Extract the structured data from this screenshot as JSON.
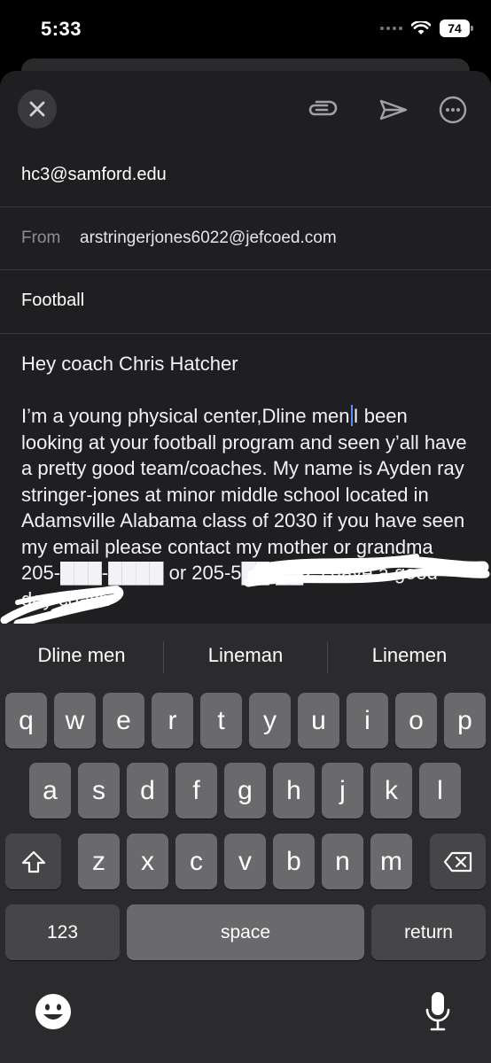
{
  "status_bar": {
    "time": "5:33",
    "battery": "74"
  },
  "compose": {
    "to": "hc3@samford.edu",
    "from_label": "From",
    "from": "arstringerjones6022@jefcoed.com",
    "subject": "Football",
    "greeting": "Hey coach Chris Hatcher",
    "body_before_cursor": "I’m a young physical center,Dline men",
    "body_after_cursor": "I been looking at your football program and seen y’all have a pretty good team/coaches. My name is Ayden ray stringer-jones at minor middle school located in Adamsville Alabama class of 2030 if you have seen my email please contact my mother or grandma 205-███-████ or 205-5██-██25 have a good day coach"
  },
  "toolbar": {
    "close_icon": "close-icon",
    "attach_icon": "paperclip-icon",
    "send_icon": "send-icon",
    "more_icon": "more-icon"
  },
  "keyboard": {
    "suggestions": [
      "Dline men",
      "Lineman",
      "Linemen"
    ],
    "row1": [
      "q",
      "w",
      "e",
      "r",
      "t",
      "y",
      "u",
      "i",
      "o",
      "p"
    ],
    "row2": [
      "a",
      "s",
      "d",
      "f",
      "g",
      "h",
      "j",
      "k",
      "l"
    ],
    "row3": [
      "z",
      "x",
      "c",
      "v",
      "b",
      "n",
      "m"
    ],
    "numbers_label": "123",
    "space_label": "space",
    "return_label": "return"
  },
  "colors": {
    "cursor": "#5e8bff",
    "key": "#6a6a6d",
    "key_dark": "#464649",
    "background": "#1f1f21"
  }
}
